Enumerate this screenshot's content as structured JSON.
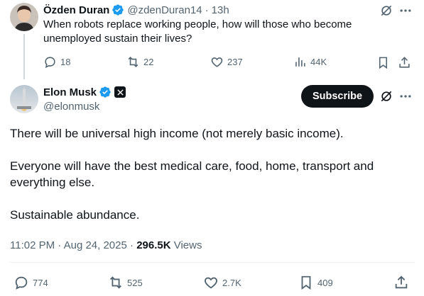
{
  "quoted_post": {
    "author_name": "Özden Duran",
    "handle": "@zdenDuran14",
    "separator": "·",
    "time": "13h",
    "text": "When robots replace working people, how will those who become unemployed sustain their lives?",
    "replies": "18",
    "reposts": "22",
    "likes": "237",
    "views": "44K"
  },
  "main_post": {
    "author_name": "Elon Musk",
    "handle": "@elonmusk",
    "subscribe_label": "Subscribe",
    "paragraphs": [
      "There will be universal high income (not merely basic income).",
      "Everyone will have the best medical care, food, home, transport and everything else.",
      "Sustainable abundance."
    ],
    "timestamp": "11:02 PM · Aug 24, 2025",
    "meta_separator": "·",
    "views_count": "296.5K",
    "views_label": "Views",
    "replies": "774",
    "reposts": "525",
    "likes": "2.7K",
    "bookmarks": "409"
  },
  "colors": {
    "text": "#0f1419",
    "muted": "#536471",
    "verified": "#1d9bf0",
    "subscribe_bg": "#0f1419"
  }
}
